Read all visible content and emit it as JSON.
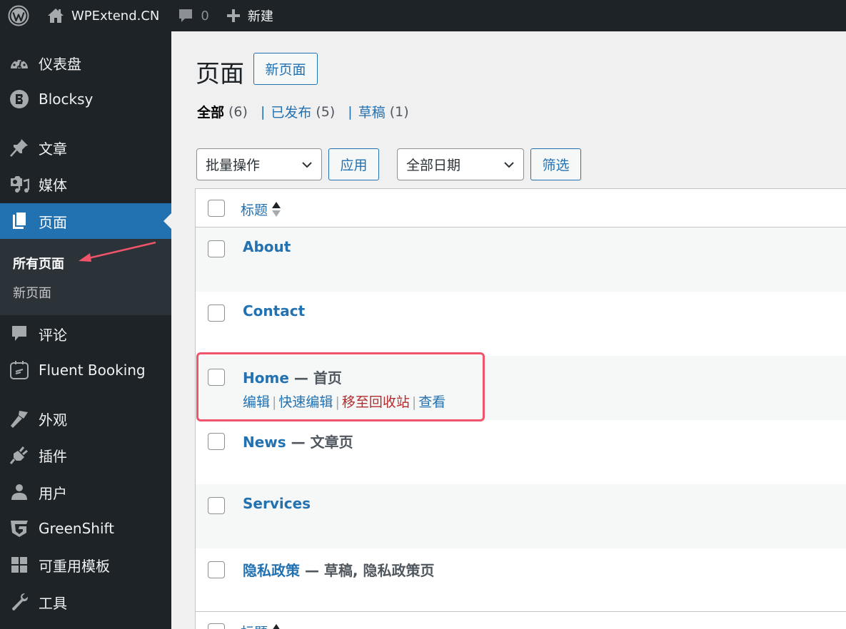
{
  "adminbar": {
    "wp_logo_icon": "wordpress-logo-icon",
    "site_name": "WPExtend.CN",
    "site_icon": "home-icon",
    "comments_count": "0",
    "comments_icon": "comment-bubble-icon",
    "new_label": "新建",
    "new_icon": "plus-icon"
  },
  "sidebar": {
    "items": [
      {
        "label": "仪表盘",
        "icon": "dashboard-gauge-icon"
      },
      {
        "label": "Blocksy",
        "icon": "blocksy-logo-icon"
      },
      {
        "label": "文章",
        "icon": "pushpin-icon"
      },
      {
        "label": "媒体",
        "icon": "media-camera-music-icon"
      },
      {
        "label": "页面",
        "icon": "pages-icon",
        "current": true
      },
      {
        "label": "评论",
        "icon": "comment-bubble-icon"
      },
      {
        "label": "Fluent Booking",
        "icon": "calendar-booking-icon"
      },
      {
        "label": "外观",
        "icon": "paintbrush-icon"
      },
      {
        "label": "插件",
        "icon": "plug-icon"
      },
      {
        "label": "用户",
        "icon": "user-icon"
      },
      {
        "label": "GreenShift",
        "icon": "greenshift-logo-icon"
      },
      {
        "label": "可重用模板",
        "icon": "grid-blocks-icon"
      },
      {
        "label": "工具",
        "icon": "wrench-icon"
      }
    ],
    "submenu": [
      {
        "label": "所有页面",
        "active": true
      },
      {
        "label": "新页面"
      }
    ]
  },
  "main": {
    "title": "页面",
    "add_new_label": "新页面",
    "views": [
      {
        "label": "全部",
        "count": "(6)",
        "current": true
      },
      {
        "label": "已发布",
        "count": "(5)"
      },
      {
        "label": "草稿",
        "count": "(1)"
      }
    ],
    "views_separator": "|",
    "bulk_actions": {
      "selected": "批量操作"
    },
    "apply_label": "应用",
    "date_filter": {
      "selected": "全部日期"
    },
    "filter_label": "筛选",
    "table": {
      "column_title": "标题",
      "rows": [
        {
          "title": "About",
          "state": ""
        },
        {
          "title": "Contact",
          "state": ""
        },
        {
          "title": "Home",
          "state": " — 首页",
          "hovered": true
        },
        {
          "title": "News",
          "state": " — 文章页"
        },
        {
          "title": "Services",
          "state": ""
        },
        {
          "title": "隐私政策",
          "state": " — 草稿, 隐私政策页"
        }
      ],
      "row_actions": {
        "edit": "编辑",
        "quick_edit": "快速编辑",
        "trash": "移至回收站",
        "view": "查看",
        "separator": "|"
      }
    }
  },
  "colors": {
    "accent": "#2271b1",
    "sidebar_bg": "#1d2327",
    "submenu_bg": "#2c3338",
    "trash": "#b32d2e",
    "annotation": "#f0546a"
  }
}
